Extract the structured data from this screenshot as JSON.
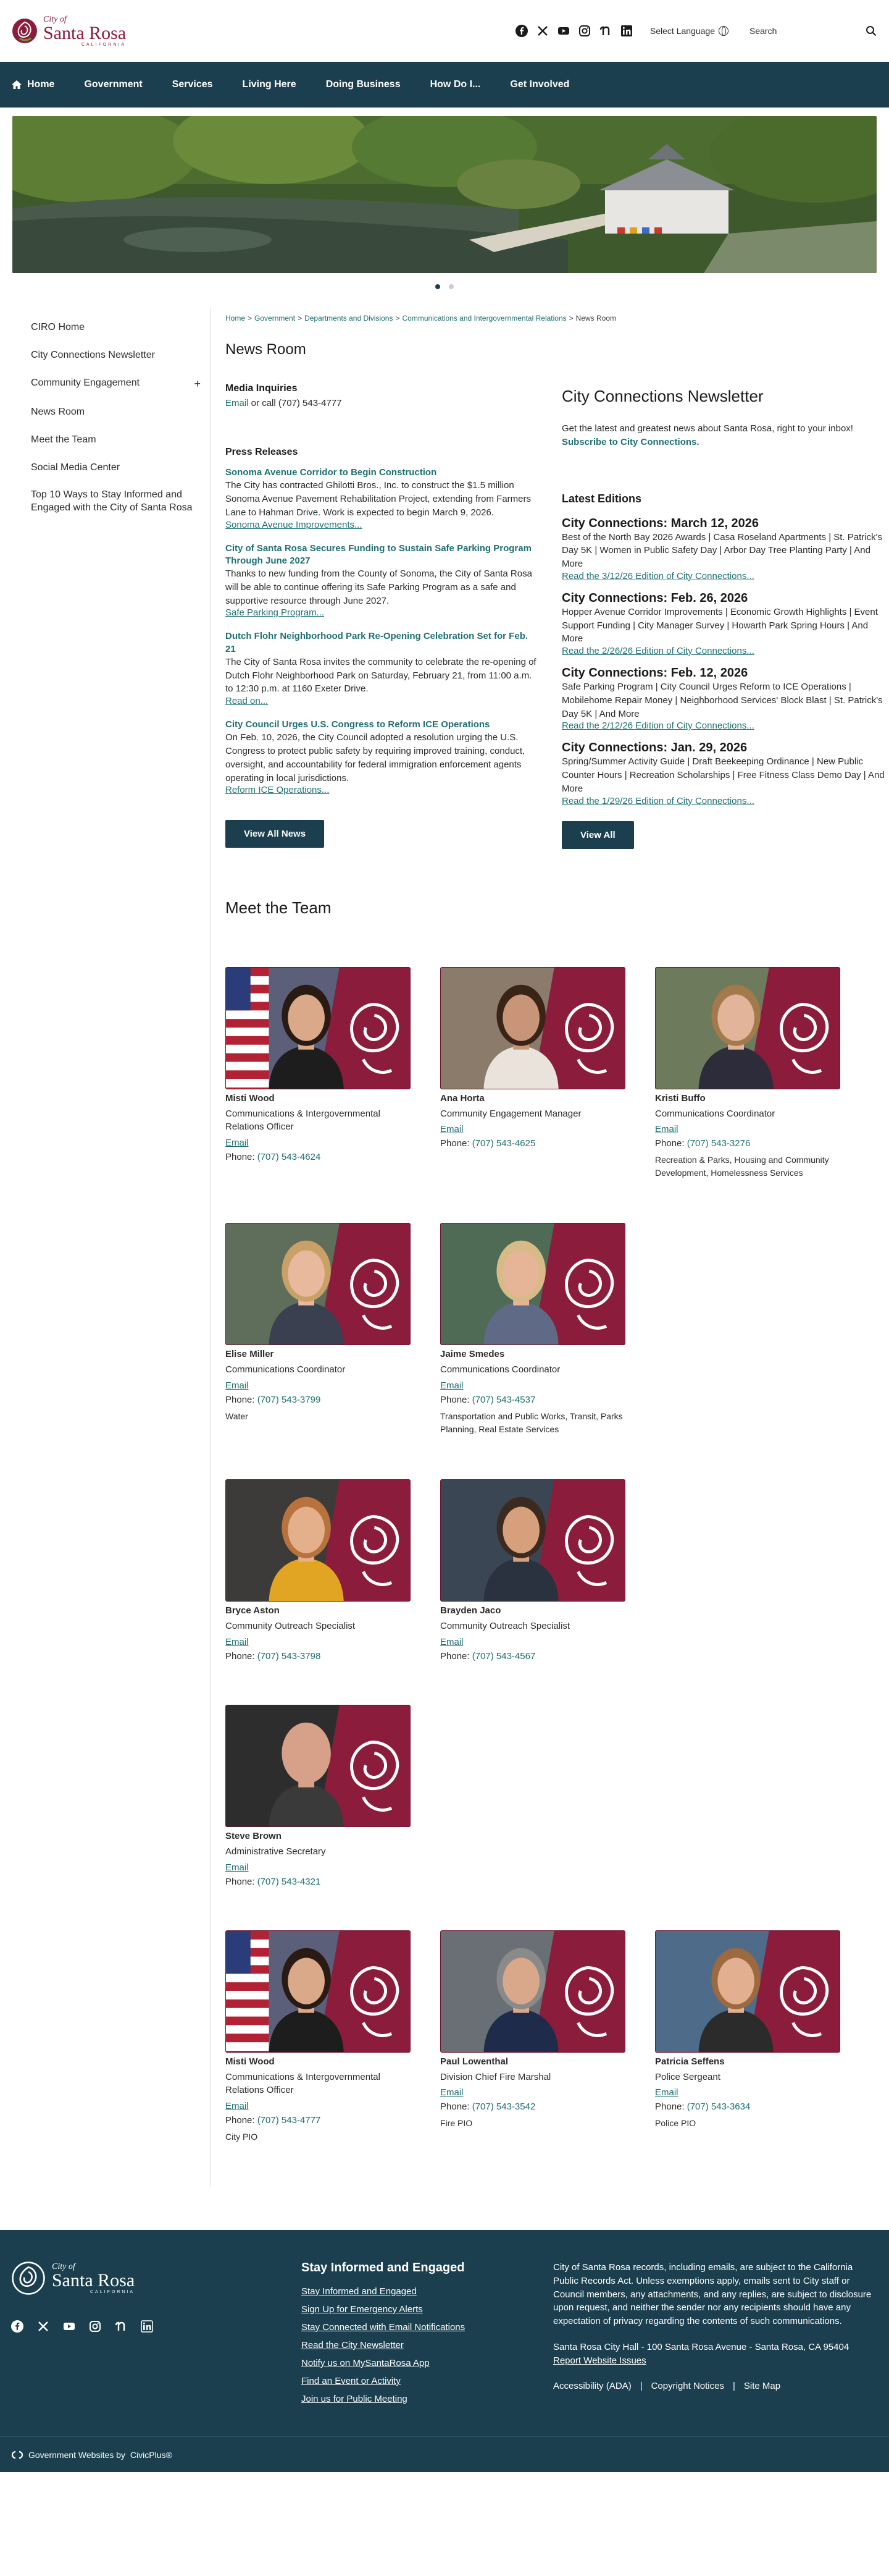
{
  "header": {
    "logo": {
      "small": "City of",
      "big": "Santa Rosa",
      "state": "CALIFORNIA"
    },
    "social_icons": [
      "facebook-icon",
      "x-icon",
      "youtube-icon",
      "instagram-icon",
      "nextdoor-icon",
      "linkedin-icon"
    ],
    "language_label": "Select Language",
    "search_placeholder": "Search"
  },
  "nav": {
    "items": [
      {
        "label": "Home"
      },
      {
        "label": "Government"
      },
      {
        "label": "Services"
      },
      {
        "label": "Living Here"
      },
      {
        "label": "Doing Business"
      },
      {
        "label": "How Do I..."
      },
      {
        "label": "Get Involved"
      }
    ]
  },
  "sidebar": {
    "items": [
      {
        "label": "CIRO Home",
        "expandable": ""
      },
      {
        "label": "City Connections Newsletter",
        "expandable": ""
      },
      {
        "label": "Community Engagement",
        "expandable": "+"
      },
      {
        "label": "News Room",
        "expandable": ""
      },
      {
        "label": "Meet the Team",
        "expandable": ""
      },
      {
        "label": "Social Media Center",
        "expandable": ""
      },
      {
        "label": "Top 10 Ways to Stay Informed and Engaged with the City of Santa Rosa",
        "expandable": ""
      }
    ]
  },
  "breadcrumb": {
    "items": [
      "Home",
      "Government",
      "Departments and Divisions",
      "Communications and Intergovernmental Relations"
    ],
    "separator": ">",
    "current": "News Room"
  },
  "page_title": "News Room",
  "media": {
    "heading": "Media Inquiries",
    "email_label": "Email",
    "line": " or call (707) 543-4777"
  },
  "press": {
    "heading": "Press Releases",
    "items": [
      {
        "title": "Sonoma Avenue Corridor to Begin Construction",
        "body": "The City has contracted Ghilotti Bros., Inc. to construct the $1.5 million Sonoma Avenue Pavement Rehabilitation Project, extending from Farmers Lane to Hahman Drive. Work is expected to begin March 9, 2026.",
        "link": "Sonoma Avenue Improvements..."
      },
      {
        "title": "City of Santa Rosa Secures Funding to Sustain Safe Parking Program Through June 2027",
        "body": "Thanks to new funding from the County of Sonoma, the City of Santa Rosa will be able to continue offering its Safe Parking Program as a safe and supportive resource through June 2027.",
        "link": "Safe Parking Program..."
      },
      {
        "title": "Dutch Flohr Neighborhood Park Re-Opening Celebration Set for Feb. 21",
        "body": "The City of Santa Rosa invites the community to celebrate the re-opening of Dutch Flohr Neighborhood Park on Saturday, February 21, from 11:00 a.m. to 12:30 p.m. at 1160 Exeter Drive.",
        "link": "Read on..."
      },
      {
        "title": "City Council Urges U.S. Congress to Reform ICE Operations",
        "body": "On Feb. 10, 2026, the City Council adopted a resolution urging the U.S. Congress to protect public safety by requiring improved training, conduct, oversight, and accountability for federal immigration enforcement agents operating in local jurisdictions.",
        "link": "Reform ICE Operations..."
      }
    ],
    "view_all": "View All News"
  },
  "newsletter": {
    "title": "City Connections Newsletter",
    "desc": "Get the latest and greatest news about Santa Rosa, right to your inbox! ",
    "subscribe": "Subscribe to City Connections.",
    "editions_heading": "Latest Editions",
    "editions": [
      {
        "title": "City Connections: March 12, 2026",
        "body": "Best of the North Bay 2026 Awards | Casa Roseland Apartments | St. Patrick's Day 5K | Women in Public Safety Day | Arbor Day Tree Planting Party | And More",
        "link": "Read the 3/12/26 Edition of City Connections..."
      },
      {
        "title": "City Connections: Feb. 26, 2026",
        "body": "Hopper Avenue Corridor Improvements | Economic Growth Highlights | Event Support Funding | City Manager Survey | Howarth Park Spring Hours | And More",
        "link": "Read the 2/26/26 Edition of City Connections..."
      },
      {
        "title": "City Connections: Feb. 12, 2026",
        "body": "Safe Parking Program | City Council Urges Reform to ICE Operations | Mobilehome Repair Money | Neighborhood Services' Block Blast | St. Patrick's Day 5K | And More",
        "link": "Read the 2/12/26 Edition of City Connections..."
      },
      {
        "title": "City Connections: Jan. 29, 2026",
        "body": "Spring/Summer Activity Guide | Draft Beekeeping Ordinance | New Public Counter Hours | Recreation Scholarships | Free Fitness Class Demo Day | And More",
        "link": "Read the 1/29/26 Edition of City Connections..."
      }
    ],
    "view_all": "View All"
  },
  "team": {
    "title": "Meet the Team",
    "email_label": "Email",
    "phone_label": "Phone: ",
    "members": [
      {
        "name": "Misti Wood",
        "title": "Communications & Intergovernmental Relations Officer",
        "phone": "(707) 543-4624",
        "extra": "",
        "bg": "#5b5f7a",
        "skin": "#d9a98a",
        "hair": "#2a1a14",
        "shirt": "#1d1d1d",
        "flag": "yes"
      },
      {
        "name": "Ana Horta",
        "title": "Community Engagement Manager",
        "phone": "(707) 543-4625",
        "extra": "",
        "bg": "#8a7b6a",
        "skin": "#c99578",
        "hair": "#3a2418",
        "shirt": "#e9e3dc",
        "flag": "no"
      },
      {
        "name": "Kristi Buffo",
        "title": "Communications Coordinator",
        "phone": "(707) 543-3276",
        "extra": "Recreation & Parks, Housing and Community Development, Homelessness Services",
        "bg": "#6e7a5c",
        "skin": "#e2b49a",
        "hair": "#a37a4c",
        "shirt": "#2c2c3a",
        "flag": "no"
      },
      {
        "name": "Elise Miller",
        "title": "Communications Coordinator",
        "phone": "(707) 543-3799",
        "extra": "Water",
        "bg": "#5e6e5a",
        "skin": "#e8b99c",
        "hair": "#c9a067",
        "shirt": "#3a4050",
        "flag": "no"
      },
      {
        "name": "Jaime Smedes",
        "title": "Communications Coordinator",
        "phone": "(707) 543-4537",
        "extra": "Transportation and Public Works, Transit, Parks Planning, Real Estate Services",
        "bg": "#4f6b55",
        "skin": "#e6b598",
        "hair": "#d7bb86",
        "shirt": "#5f6a86",
        "flag": "no"
      },
      {
        "name": "Bryce Aston",
        "title": "Community Outreach Specialist",
        "phone": "(707) 543-3798",
        "extra": "",
        "bg": "#3d3b3a",
        "skin": "#e4b08c",
        "hair": "#b7723e",
        "shirt": "#e1a423",
        "flag": "no"
      },
      {
        "name": "Brayden Jaco",
        "title": "Community Outreach Specialist",
        "phone": "(707) 543-4567",
        "extra": "",
        "bg": "#3b4654",
        "skin": "#d6a07c",
        "hair": "#3b2a1f",
        "shirt": "#2a3240",
        "flag": "no"
      },
      {
        "name": "Steve Brown",
        "title": "Administrative Secretary",
        "phone": "(707) 543-4321",
        "extra": "",
        "bg": "#2d2d2d",
        "skin": "#d7a088",
        "hair": "#d7a088",
        "shirt": "#3a3a3a",
        "flag": "no"
      },
      {
        "name": "Misti Wood",
        "title": "Communications & Intergovernmental Relations Officer",
        "phone": "(707) 543-4777",
        "extra": "City PIO",
        "bg": "#5b5f7a",
        "skin": "#d9a98a",
        "hair": "#2a1a14",
        "shirt": "#1d1d1d",
        "flag": "yes"
      },
      {
        "name": "Paul Lowenthal",
        "title": "Division Chief Fire Marshal",
        "phone": "(707) 543-3542",
        "extra": "Fire PIO",
        "bg": "#6a6f75",
        "skin": "#d9a88a",
        "hair": "#8a8a8a",
        "shirt": "#1f2b4a",
        "flag": "no"
      },
      {
        "name": "Patricia Seffens",
        "title": "Police Sergeant",
        "phone": "(707) 543-3634",
        "extra": "Police PIO",
        "bg": "#4e6b8a",
        "skin": "#e2b091",
        "hair": "#9c6a3e",
        "shirt": "#2b2b2b",
        "flag": "no"
      }
    ]
  },
  "footer": {
    "heading": "Stay Informed and Engaged",
    "links": [
      "Stay Informed and Engaged",
      "Sign Up for Emergency Alerts",
      "Stay Connected with Email Notifications",
      "Read the City Newsletter",
      "Notify us on MySantaRosa App",
      "Find an Event or Activity",
      "Join us for Public Meeting"
    ],
    "disclaimer": "City of Santa Rosa records, including emails, are subject to the California Public Records Act. Unless exemptions apply, emails sent to City staff or Council members, any attachments, and any replies, are subject to disclosure upon request, and neither the sender nor any recipients should have any expectation of privacy regarding the contents of such communications.",
    "address": "Santa Rosa City Hall - 100 Santa Rosa Avenue - Santa Rosa, CA 95404",
    "report": "Report Website Issues",
    "bottom_links": [
      "Accessibility (ADA)",
      "Copyright Notices",
      "Site Map"
    ],
    "separator": "|",
    "powered_prefix": "Government Websites by ",
    "powered_link": "CivicPlus®"
  },
  "colors": {
    "nav": "#1b3f4e",
    "brand": "#8b1c3b",
    "link": "#1f6f72"
  }
}
